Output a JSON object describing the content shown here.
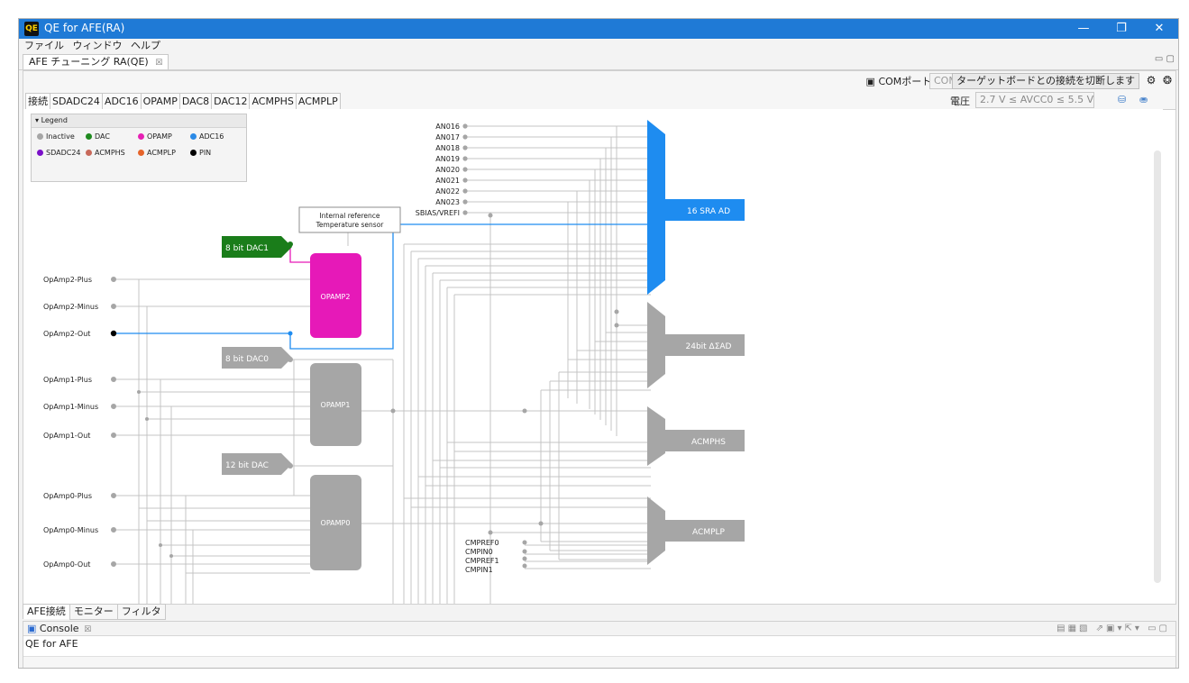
{
  "window": {
    "title": "QE for AFE(RA)",
    "minimize": "—",
    "restore": "❐",
    "close": "✕"
  },
  "menu": [
    "ファイル",
    "ウィンドウ",
    "ヘルプ"
  ],
  "editor_tab": {
    "label": "AFE チューニング RA(QE)",
    "close": "☒"
  },
  "toolbar": {
    "com_label": "COMポート:",
    "com_value": "COM4",
    "disconnect": "ターゲットボードとの接続を切断します",
    "voltage_label": "電圧",
    "voltage_value": "2.7 V ≤ AVCC0 ≤ 5.5 V"
  },
  "panel_tabs": [
    "接続",
    "SDADC24",
    "ADC16",
    "OPAMP",
    "DAC8",
    "DAC12",
    "ACMPHS",
    "ACMPLP"
  ],
  "legend": {
    "title": "Legend",
    "items": [
      {
        "label": "Inactive",
        "color": "#a6a6a6"
      },
      {
        "label": "DAC",
        "color": "#1f8a1f"
      },
      {
        "label": "OPAMP",
        "color": "#e620b4"
      },
      {
        "label": "ADC16",
        "color": "#2a8ae6"
      },
      {
        "label": "SDADC24",
        "color": "#7a10c8"
      },
      {
        "label": "ACMPHS",
        "color": "#c8695a"
      },
      {
        "label": "ACMPLP",
        "color": "#e6642a"
      },
      {
        "label": "PIN",
        "color": "#000000"
      }
    ]
  },
  "diagram": {
    "left_pins": [
      "OpAmp2-Plus",
      "OpAmp2-Minus",
      "OpAmp2-Out",
      "OpAmp1-Plus",
      "OpAmp1-Minus",
      "OpAmp1-Out",
      "OpAmp0-Plus",
      "OpAmp0-Minus",
      "OpAmp0-Out"
    ],
    "an_pins": [
      "AN016",
      "AN017",
      "AN018",
      "AN019",
      "AN020",
      "AN021",
      "AN022",
      "AN023",
      "SBIAS/VREFI"
    ],
    "cmp_pins": [
      "CMPREF0",
      "CMPIN0",
      "CMPREF1",
      "CMPIN1"
    ],
    "dacs": [
      "8 bit DAC1",
      "8 bit DAC0",
      "12 bit DAC"
    ],
    "opamps": [
      "OPAMP2",
      "OPAMP1",
      "OPAMP0"
    ],
    "internal_ref": [
      "Internal reference",
      "Temperature sensor"
    ],
    "converters": [
      "16 SRA AD",
      "24bit  ΔΣAD",
      "ACMPHS",
      "ACMPLP"
    ],
    "colors": {
      "inactive": "#a6a6a6",
      "dac": "#1a7d1a",
      "opamp": "#e619b8",
      "adc16": "#1e8cf0",
      "pin": "#000000",
      "wire": "#c4c4c4"
    }
  },
  "bottom_tabs": [
    "AFE接続",
    "モニター",
    "フィルタ"
  ],
  "console": {
    "tab": "Console",
    "close": "☒",
    "text": "QE for AFE"
  }
}
